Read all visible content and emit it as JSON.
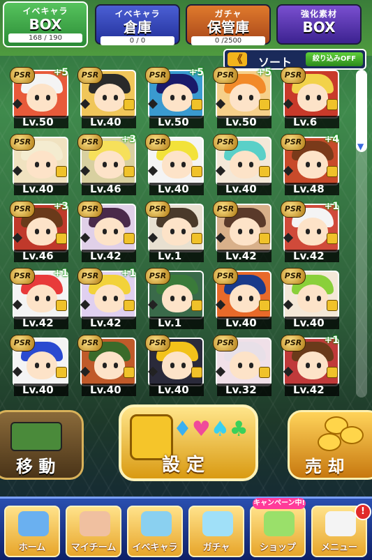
{
  "tabs": [
    {
      "title": "イベキャラ",
      "label": "BOX",
      "count": "168 / 190",
      "style": "active"
    },
    {
      "title": "イベキャラ",
      "label": "倉庫",
      "count": "0 /  0",
      "style": "blue"
    },
    {
      "title": "ガチャ",
      "label": "保管庫",
      "count": "0  /2500",
      "style": "orange"
    },
    {
      "title": "強化素材",
      "label": "BOX",
      "count": "",
      "style": "purple"
    }
  ],
  "sortbar": {
    "arrow": "《",
    "label": "ソート",
    "filter": "絞り込みOFF"
  },
  "cards": [
    {
      "rank": "PSR",
      "plus": "+5",
      "level": "Lv.50",
      "hair": "#f4f4f4",
      "bg": "#e85a3a",
      "locked": false
    },
    {
      "rank": "PSR",
      "plus": "",
      "level": "Lv.40",
      "hair": "#2a2a2a",
      "bg": "#f0c65a",
      "locked": true
    },
    {
      "rank": "PSR",
      "plus": "+5",
      "level": "Lv.50",
      "hair": "#1a1a6a",
      "bg": "#3a9ad0",
      "locked": true
    },
    {
      "rank": "PSR",
      "plus": "+5",
      "level": "Lv.50",
      "hair": "#f28a2a",
      "bg": "#f6d08a",
      "locked": true
    },
    {
      "rank": "PSR",
      "plus": "",
      "level": "Lv.6",
      "hair": "#f2d24a",
      "bg": "#c83a2a",
      "locked": true
    },
    {
      "rank": "PSR",
      "plus": "",
      "level": "Lv.40",
      "hair": "#f4ecd0",
      "bg": "#f0e2c0",
      "locked": true
    },
    {
      "rank": "PSR",
      "plus": "+3",
      "level": "Lv.46",
      "hair": "#f6e05a",
      "bg": "#d8d0a0",
      "locked": true
    },
    {
      "rank": "PSR",
      "plus": "",
      "level": "Lv.40",
      "hair": "#f2e23a",
      "bg": "#f4f4f4",
      "locked": true
    },
    {
      "rank": "PSR",
      "plus": "",
      "level": "Lv.40",
      "hair": "#5ad0c8",
      "bg": "#f4e8d8",
      "locked": true
    },
    {
      "rank": "PSR",
      "plus": "+4",
      "level": "Lv.48",
      "hair": "#7a3a1a",
      "bg": "#c84a2a",
      "locked": true
    },
    {
      "rank": "PSR",
      "plus": "+3",
      "level": "Lv.46",
      "hair": "#6a3a1a",
      "bg": "#c0392b",
      "locked": true
    },
    {
      "rank": "PSR",
      "plus": "",
      "level": "Lv.42",
      "hair": "#4a2a4a",
      "bg": "#e0d0e8",
      "locked": true
    },
    {
      "rank": "PSR",
      "plus": "",
      "level": "Lv.1",
      "hair": "#4a3a2a",
      "bg": "#e8e0d0",
      "locked": true
    },
    {
      "rank": "PSR",
      "plus": "",
      "level": "Lv.42",
      "hair": "#5a3a2a",
      "bg": "#d8b08a",
      "locked": true
    },
    {
      "rank": "PSR",
      "plus": "+1",
      "level": "Lv.42",
      "hair": "#f4f4f4",
      "bg": "#d04a3a",
      "locked": true
    },
    {
      "rank": "PSR",
      "plus": "+1",
      "level": "Lv.42",
      "hair": "#e83a3a",
      "bg": "#f4f4f4",
      "locked": true
    },
    {
      "rank": "PSR",
      "plus": "+1",
      "level": "Lv.42",
      "hair": "#f2d23a",
      "bg": "#e0d0f0",
      "locked": true
    },
    {
      "rank": "PSR",
      "plus": "",
      "level": "Lv.1",
      "hair": "#3a7a3a",
      "bg": "#3a6a4a",
      "locked": true
    },
    {
      "rank": "PSR",
      "plus": "",
      "level": "Lv.40",
      "hair": "#1a3a8a",
      "bg": "#e86a2a",
      "locked": true
    },
    {
      "rank": "PSR",
      "plus": "",
      "level": "Lv.40",
      "hair": "#8ad03a",
      "bg": "#f4e8d8",
      "locked": true
    },
    {
      "rank": "PSR",
      "plus": "",
      "level": "Lv.40",
      "hair": "#2a4ad0",
      "bg": "#f4f4f4",
      "locked": true
    },
    {
      "rank": "PSR",
      "plus": "",
      "level": "Lv.40",
      "hair": "#3a6a2a",
      "bg": "#c05a2a",
      "locked": true
    },
    {
      "rank": "PSR",
      "plus": "",
      "level": "Lv.40",
      "hair": "#f2c21a",
      "bg": "#2a2a3a",
      "locked": true
    },
    {
      "rank": "PSR",
      "plus": "",
      "level": "Lv.32",
      "hair": "#e8e0e8",
      "bg": "#f0e0e8",
      "locked": true
    },
    {
      "rank": "PSR",
      "plus": "+1",
      "level": "Lv.42",
      "hair": "#6a3a1a",
      "bg": "#c03a3a",
      "locked": true
    }
  ],
  "actions": {
    "move": "移 動",
    "set": "設 定",
    "sell": "売 却"
  },
  "nav": [
    {
      "label": "ホーム",
      "icon": "home-icon",
      "color": "#6ab0f0"
    },
    {
      "label": "マイチーム",
      "icon": "team-icon",
      "color": "#f0c0a0"
    },
    {
      "label": "イベキャラ",
      "icon": "event-chara-icon",
      "color": "#8ad0f0"
    },
    {
      "label": "ガチャ",
      "icon": "gacha-icon",
      "color": "#a0e0f8"
    },
    {
      "label": "ショップ",
      "icon": "shop-icon",
      "color": "#9ae06a"
    },
    {
      "label": "メニュー",
      "icon": "menu-icon",
      "color": "#f4f4f4"
    }
  ],
  "campaign": "キャンペーン中!",
  "notification_badge": "!"
}
